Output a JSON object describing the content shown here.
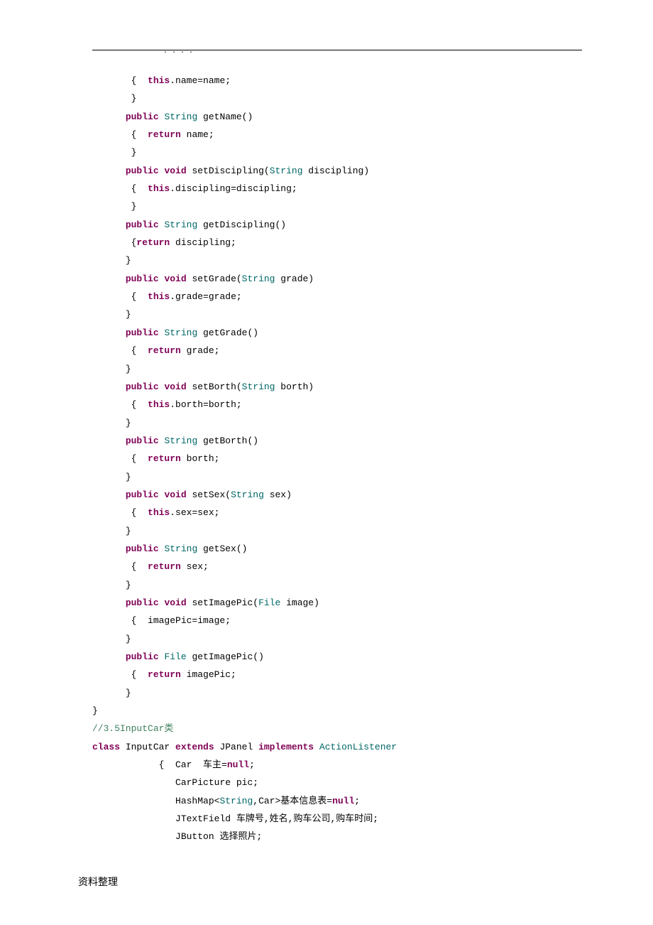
{
  "header": {
    "dots": ".          .        .                .                "
  },
  "code": {
    "lines": [
      {
        "indent": 2,
        "tokens": [
          {
            "t": "normal",
            "v": " {  "
          },
          {
            "t": "kw",
            "v": "this"
          },
          {
            "t": "normal",
            "v": ".name=name;"
          }
        ]
      },
      {
        "indent": 2,
        "tokens": [
          {
            "t": "normal",
            "v": " }"
          }
        ]
      },
      {
        "indent": 2,
        "tokens": [
          {
            "t": "kw",
            "v": "public"
          },
          {
            "t": "normal",
            "v": " "
          },
          {
            "t": "type",
            "v": "String"
          },
          {
            "t": "normal",
            "v": " getName()"
          }
        ]
      },
      {
        "indent": 2,
        "tokens": [
          {
            "t": "normal",
            "v": " {  "
          },
          {
            "t": "kw",
            "v": "return"
          },
          {
            "t": "normal",
            "v": " name;"
          }
        ]
      },
      {
        "indent": 2,
        "tokens": [
          {
            "t": "normal",
            "v": " }"
          }
        ]
      },
      {
        "indent": 2,
        "tokens": [
          {
            "t": "kw",
            "v": "public"
          },
          {
            "t": "normal",
            "v": " "
          },
          {
            "t": "kw",
            "v": "void"
          },
          {
            "t": "normal",
            "v": " setDiscipling("
          },
          {
            "t": "type",
            "v": "String"
          },
          {
            "t": "normal",
            "v": " discipling)"
          }
        ]
      },
      {
        "indent": 2,
        "tokens": [
          {
            "t": "normal",
            "v": " {  "
          },
          {
            "t": "kw",
            "v": "this"
          },
          {
            "t": "normal",
            "v": ".discipling=discipling;"
          }
        ]
      },
      {
        "indent": 2,
        "tokens": [
          {
            "t": "normal",
            "v": " }"
          }
        ]
      },
      {
        "indent": 2,
        "tokens": [
          {
            "t": "kw",
            "v": "public"
          },
          {
            "t": "normal",
            "v": " "
          },
          {
            "t": "type",
            "v": "String"
          },
          {
            "t": "normal",
            "v": " getDiscipling()"
          }
        ]
      },
      {
        "indent": 2,
        "tokens": [
          {
            "t": "normal",
            "v": " {"
          },
          {
            "t": "kw",
            "v": "return"
          },
          {
            "t": "normal",
            "v": " discipling;"
          }
        ]
      },
      {
        "indent": 2,
        "tokens": [
          {
            "t": "normal",
            "v": "}"
          }
        ]
      },
      {
        "indent": 2,
        "tokens": [
          {
            "t": "kw",
            "v": "public"
          },
          {
            "t": "normal",
            "v": " "
          },
          {
            "t": "kw",
            "v": "void"
          },
          {
            "t": "normal",
            "v": " setGrade("
          },
          {
            "t": "type",
            "v": "String"
          },
          {
            "t": "normal",
            "v": " grade)"
          }
        ]
      },
      {
        "indent": 2,
        "tokens": [
          {
            "t": "normal",
            "v": " {  "
          },
          {
            "t": "kw",
            "v": "this"
          },
          {
            "t": "normal",
            "v": ".grade=grade;"
          }
        ]
      },
      {
        "indent": 2,
        "tokens": [
          {
            "t": "normal",
            "v": "}"
          }
        ]
      },
      {
        "indent": 2,
        "tokens": [
          {
            "t": "kw",
            "v": "public"
          },
          {
            "t": "normal",
            "v": " "
          },
          {
            "t": "type",
            "v": "String"
          },
          {
            "t": "normal",
            "v": " getGrade()"
          }
        ]
      },
      {
        "indent": 2,
        "tokens": [
          {
            "t": "normal",
            "v": " {  "
          },
          {
            "t": "kw",
            "v": "return"
          },
          {
            "t": "normal",
            "v": " grade;"
          }
        ]
      },
      {
        "indent": 2,
        "tokens": [
          {
            "t": "normal",
            "v": "}"
          }
        ]
      },
      {
        "indent": 2,
        "tokens": [
          {
            "t": "kw",
            "v": "public"
          },
          {
            "t": "normal",
            "v": " "
          },
          {
            "t": "kw",
            "v": "void"
          },
          {
            "t": "normal",
            "v": " setBorth("
          },
          {
            "t": "type",
            "v": "String"
          },
          {
            "t": "normal",
            "v": " borth)"
          }
        ]
      },
      {
        "indent": 2,
        "tokens": [
          {
            "t": "normal",
            "v": " {  "
          },
          {
            "t": "kw",
            "v": "this"
          },
          {
            "t": "normal",
            "v": ".borth=borth;"
          }
        ]
      },
      {
        "indent": 2,
        "tokens": [
          {
            "t": "normal",
            "v": "}"
          }
        ]
      },
      {
        "indent": 2,
        "tokens": [
          {
            "t": "kw",
            "v": "public"
          },
          {
            "t": "normal",
            "v": " "
          },
          {
            "t": "type",
            "v": "String"
          },
          {
            "t": "normal",
            "v": " getBorth()"
          }
        ]
      },
      {
        "indent": 2,
        "tokens": [
          {
            "t": "normal",
            "v": " {  "
          },
          {
            "t": "kw",
            "v": "return"
          },
          {
            "t": "normal",
            "v": " borth;"
          }
        ]
      },
      {
        "indent": 2,
        "tokens": [
          {
            "t": "normal",
            "v": "}"
          }
        ]
      },
      {
        "indent": 2,
        "tokens": [
          {
            "t": "kw",
            "v": "public"
          },
          {
            "t": "normal",
            "v": " "
          },
          {
            "t": "kw",
            "v": "void"
          },
          {
            "t": "normal",
            "v": " setSex("
          },
          {
            "t": "type",
            "v": "String"
          },
          {
            "t": "normal",
            "v": " sex)"
          }
        ]
      },
      {
        "indent": 2,
        "tokens": [
          {
            "t": "normal",
            "v": " {  "
          },
          {
            "t": "kw",
            "v": "this"
          },
          {
            "t": "normal",
            "v": ".sex=sex;"
          }
        ]
      },
      {
        "indent": 2,
        "tokens": [
          {
            "t": "normal",
            "v": "}"
          }
        ]
      },
      {
        "indent": 2,
        "tokens": [
          {
            "t": "kw",
            "v": "public"
          },
          {
            "t": "normal",
            "v": " "
          },
          {
            "t": "type",
            "v": "String"
          },
          {
            "t": "normal",
            "v": " getSex()"
          }
        ]
      },
      {
        "indent": 2,
        "tokens": [
          {
            "t": "normal",
            "v": " {  "
          },
          {
            "t": "kw",
            "v": "return"
          },
          {
            "t": "normal",
            "v": " sex;"
          }
        ]
      },
      {
        "indent": 2,
        "tokens": [
          {
            "t": "normal",
            "v": "}"
          }
        ]
      },
      {
        "indent": 2,
        "tokens": [
          {
            "t": "kw",
            "v": "public"
          },
          {
            "t": "normal",
            "v": " "
          },
          {
            "t": "kw",
            "v": "void"
          },
          {
            "t": "normal",
            "v": " setImagePic("
          },
          {
            "t": "type",
            "v": "File"
          },
          {
            "t": "normal",
            "v": " image)"
          }
        ]
      },
      {
        "indent": 2,
        "tokens": [
          {
            "t": "normal",
            "v": " {  imagePic=image;"
          }
        ]
      },
      {
        "indent": 2,
        "tokens": [
          {
            "t": "normal",
            "v": "}"
          }
        ]
      },
      {
        "indent": 2,
        "tokens": [
          {
            "t": "kw",
            "v": "public"
          },
          {
            "t": "normal",
            "v": " "
          },
          {
            "t": "type",
            "v": "File"
          },
          {
            "t": "normal",
            "v": " getImagePic()"
          }
        ]
      },
      {
        "indent": 2,
        "tokens": [
          {
            "t": "normal",
            "v": " {  "
          },
          {
            "t": "kw",
            "v": "return"
          },
          {
            "t": "normal",
            "v": " imagePic;"
          }
        ]
      },
      {
        "indent": 2,
        "tokens": [
          {
            "t": "normal",
            "v": "}"
          }
        ]
      },
      {
        "indent": 0,
        "tokens": [
          {
            "t": "normal",
            "v": "}"
          }
        ]
      },
      {
        "indent": 0,
        "tokens": [
          {
            "t": "normal",
            "v": ""
          }
        ]
      },
      {
        "indent": 0,
        "tokens": [
          {
            "t": "comment",
            "v": "//3.5InputCar类"
          }
        ]
      },
      {
        "indent": 0,
        "tokens": [
          {
            "t": "kw",
            "v": "class"
          },
          {
            "t": "normal",
            "v": " InputCar "
          },
          {
            "t": "kw",
            "v": "extends"
          },
          {
            "t": "normal",
            "v": " JPanel "
          },
          {
            "t": "kw",
            "v": "implements"
          },
          {
            "t": "normal",
            "v": " "
          },
          {
            "t": "type",
            "v": "ActionListener"
          }
        ]
      },
      {
        "indent": 4,
        "tokens": [
          {
            "t": "normal",
            "v": "{  Car  车主="
          },
          {
            "t": "kw",
            "v": "null"
          },
          {
            "t": "normal",
            "v": ";"
          }
        ]
      },
      {
        "indent": 5,
        "tokens": [
          {
            "t": "normal",
            "v": "CarPicture pic;"
          }
        ]
      },
      {
        "indent": 5,
        "tokens": [
          {
            "t": "normal",
            "v": "HashMap<"
          },
          {
            "t": "type",
            "v": "String"
          },
          {
            "t": "normal",
            "v": ",Car>基本信息表="
          },
          {
            "t": "kw",
            "v": "null"
          },
          {
            "t": "normal",
            "v": ";"
          }
        ]
      },
      {
        "indent": 5,
        "tokens": [
          {
            "t": "normal",
            "v": "JTextField 车牌号,姓名,购车公司,购车时间;"
          }
        ]
      },
      {
        "indent": 5,
        "tokens": [
          {
            "t": "normal",
            "v": "JButton 选择照片;"
          }
        ]
      }
    ]
  },
  "footer": {
    "text": "资料整理"
  }
}
